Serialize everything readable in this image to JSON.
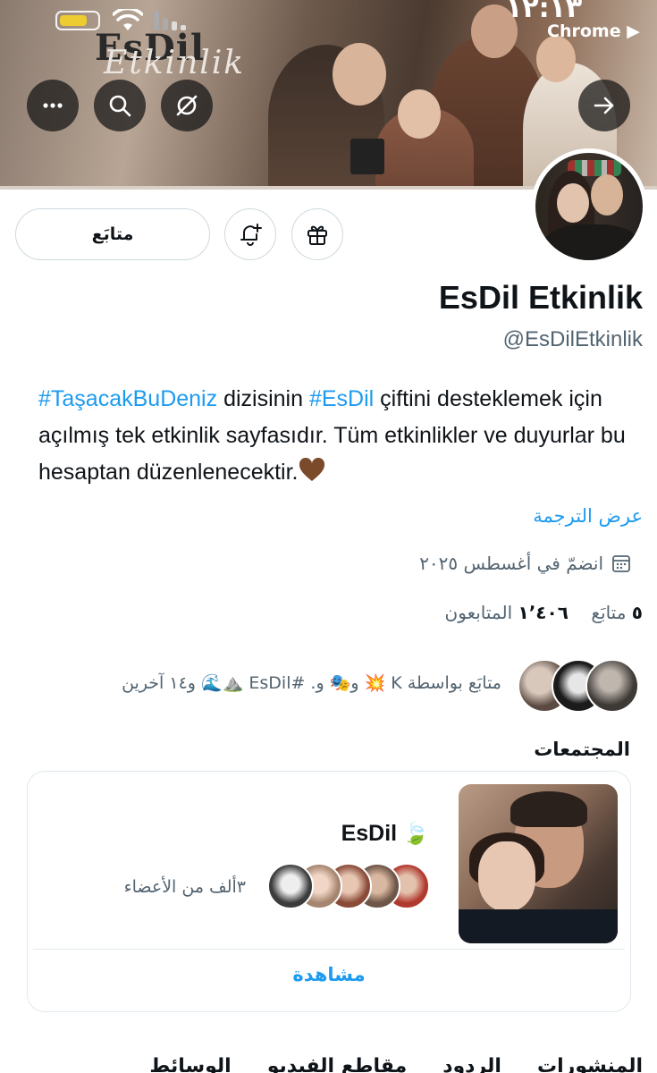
{
  "status_bar": {
    "time": "١٢:١٣",
    "back_app": "Chrome ▶",
    "battery_level": 0.75
  },
  "banner": {
    "logo_top": "EsDil",
    "logo_script": "Etkinlik"
  },
  "icons": {
    "more": "more-icon",
    "search": "search-icon",
    "hide": "hide-icon",
    "share": "arrow-right-icon",
    "notify": "bell-plus-icon",
    "gift": "gift-icon",
    "calendar": "calendar-icon"
  },
  "profile": {
    "follow_label": "متابَع",
    "display_name": "EsDil Etkinlik",
    "handle": "@EsDilEtkinlik",
    "bio": {
      "hashtag1": "#TaşacakBuDeniz",
      "text1": " dizisinin ",
      "hashtag2": "#EsDil",
      "text2": " çiftini desteklemek için açılmış tek etkinlik sayfasıdır. Tüm etkinlikler ve duyurlar bu hesaptan düzenlenecektir."
    },
    "translate_label": "عرض الترجمة",
    "joined": "انضمّ في أغسطس ٢٠٢٥",
    "following_count": "٥",
    "following_label": "متابَع",
    "followers_count": "١٬٤٠٦",
    "followers_label": "المتابعون",
    "followed_by": "متابَع بواسطة K 💥 و🎭 و. #EsDil ⛰️🌊 و١٤ آخرين"
  },
  "communities": {
    "title": "المجتمعات",
    "card": {
      "name": "EsDil",
      "leaf": "🍃",
      "members": "٣ألف من الأعضاء",
      "view_label": "مشاهدة"
    }
  },
  "tabs": {
    "labels": [
      "المنشورات",
      "الردود",
      "مقاطع الفيديو",
      "الوسائط"
    ]
  },
  "colors": {
    "accent": "#1d9bf0",
    "text": "#0f1419",
    "muted": "#536471",
    "border": "#cfd9de",
    "battery": "#f5d328"
  }
}
